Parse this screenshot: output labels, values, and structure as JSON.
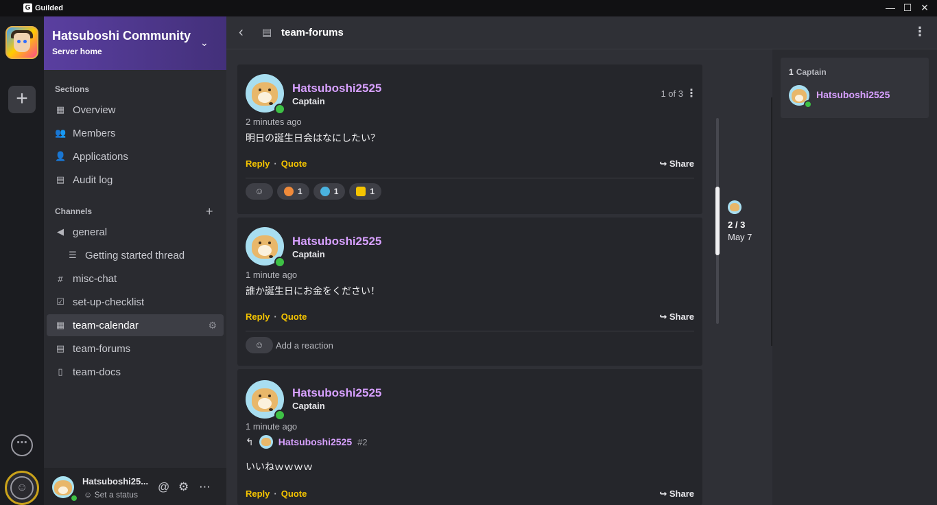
{
  "app": {
    "name": "Guilded"
  },
  "window": {
    "minimize": "—",
    "maximize": "☐",
    "close": "✕"
  },
  "rail": {
    "add_label": "+"
  },
  "server": {
    "name": "Hatsuboshi Community",
    "subtitle": "Server home"
  },
  "sections": {
    "title": "Sections",
    "items": [
      {
        "label": "Overview",
        "icon": "grid-icon"
      },
      {
        "label": "Members",
        "icon": "members-icon"
      },
      {
        "label": "Applications",
        "icon": "add-user-icon"
      },
      {
        "label": "Audit log",
        "icon": "clipboard-icon"
      }
    ]
  },
  "channels": {
    "title": "Channels",
    "items": [
      {
        "label": "general",
        "icon": "megaphone-icon"
      },
      {
        "label": "Getting started thread",
        "icon": "thread-icon"
      },
      {
        "label": "misc-chat",
        "icon": "hash-icon"
      },
      {
        "label": "set-up-checklist",
        "icon": "checklist-icon"
      },
      {
        "label": "team-calendar",
        "icon": "calendar-icon",
        "active": true
      },
      {
        "label": "team-forums",
        "icon": "forum-icon"
      },
      {
        "label": "team-docs",
        "icon": "doc-icon"
      }
    ]
  },
  "user": {
    "name": "Hatsuboshi25...",
    "status": "Set a status"
  },
  "header": {
    "title": "team-forums"
  },
  "posts": [
    {
      "user": "Hatsuboshi2525",
      "role": "Captain",
      "time": "2 minutes ago",
      "text": "明日の誕生日会はなにしたい？",
      "pager": "1 of 3",
      "reactions": [
        {
          "count": "1",
          "color": "#f08a3a"
        },
        {
          "count": "1",
          "color": "#4ab3e0"
        },
        {
          "count": "1",
          "color": "#f5c400"
        }
      ]
    },
    {
      "user": "Hatsuboshi2525",
      "role": "Captain",
      "time": "1 minute ago",
      "text": "誰か誕生日にお金をください！",
      "add_reaction": "Add a reaction"
    },
    {
      "user": "Hatsuboshi2525",
      "role": "Captain",
      "time": "1 minute ago",
      "reply_to": "Hatsuboshi2525",
      "reply_num": "#2",
      "text": "いいねｗｗｗｗ"
    }
  ],
  "actions": {
    "reply": "Reply",
    "quote": "Quote",
    "share": "Share"
  },
  "jump": {
    "count": "2 / 3",
    "date": "May 7"
  },
  "members": {
    "role_count": "1",
    "role": "Captain",
    "name": "Hatsuboshi2525"
  }
}
